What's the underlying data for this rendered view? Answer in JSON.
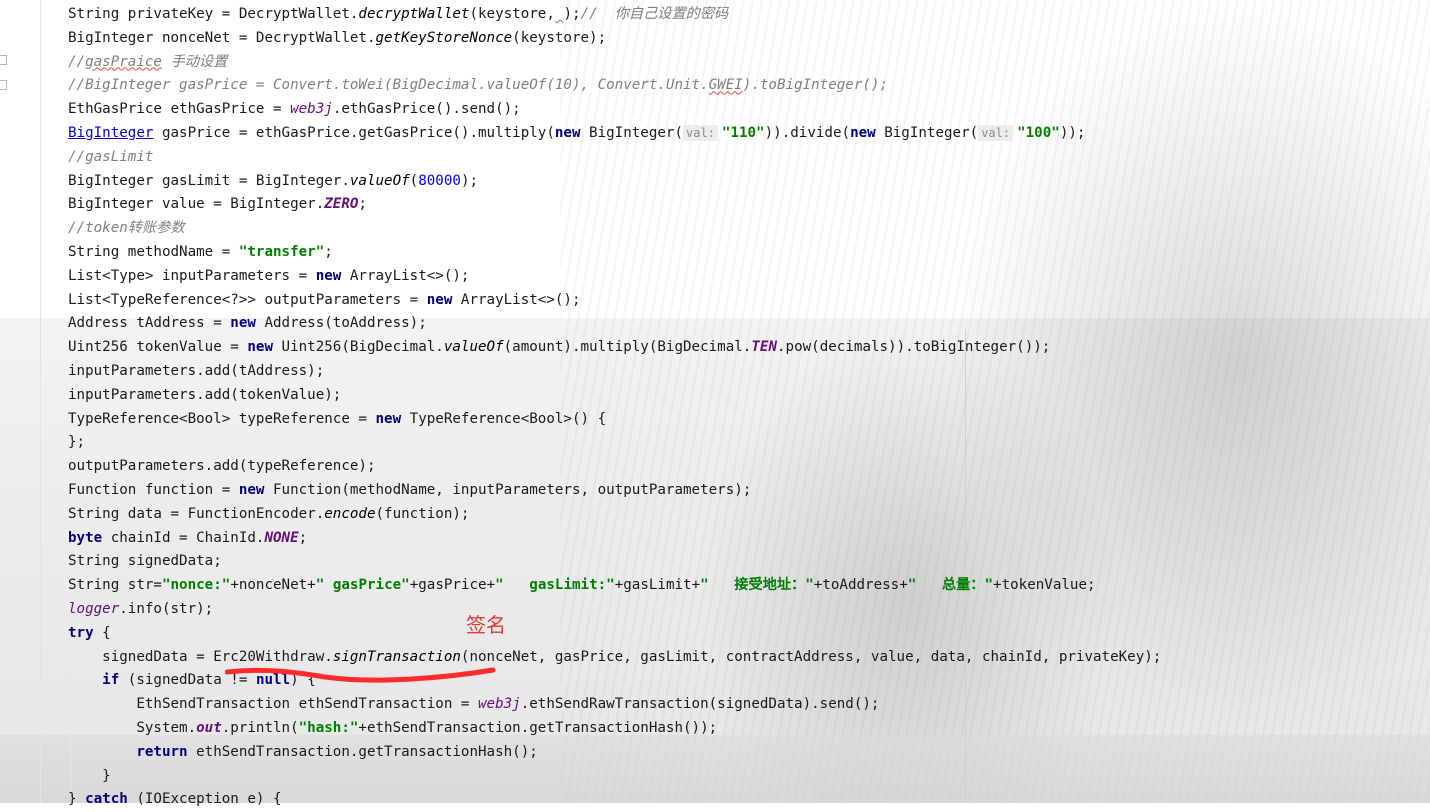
{
  "editor": {
    "annotation_label": "签名",
    "lines": [
      [
        {
          "t": "String privateKey = DecryptWallet."
        },
        {
          "t": "decryptWallet",
          "c": "st"
        },
        {
          "t": "(keystore,"
        },
        {
          "t": " ",
          "c": "squig"
        },
        {
          "t": ");"
        },
        {
          "t": "//  你自己设置的密码",
          "c": "cm"
        }
      ],
      [
        {
          "t": "BigInteger nonceNet = DecryptWallet."
        },
        {
          "t": "getKeyStoreNonce",
          "c": "st"
        },
        {
          "t": "(keystore);"
        }
      ],
      [
        {
          "t": "//",
          "c": "cm"
        },
        {
          "t": "gasPraice",
          "c": "cm squig"
        },
        {
          "t": " 手动设置",
          "c": "cm"
        }
      ],
      [
        {
          "t": "//BigInteger gasPrice = Convert.toWei(BigDecimal.valueOf(10), Convert.Unit.",
          "c": "cm"
        },
        {
          "t": "GWEI",
          "c": "cm squig"
        },
        {
          "t": ").toBigInteger();",
          "c": "cm"
        }
      ],
      [
        {
          "t": "EthGasPrice ethGasPrice = "
        },
        {
          "t": "web3j",
          "c": "fi"
        },
        {
          "t": ".ethGasPrice().send();"
        }
      ],
      [
        {
          "t": "BigInteger",
          "c": "lnk"
        },
        {
          "t": " gasPrice = ethGasPrice.getGasPrice().multiply("
        },
        {
          "t": "new",
          "c": "kw"
        },
        {
          "t": " BigInteger("
        },
        {
          "t": "val:",
          "c": "hint"
        },
        {
          "t": "\"110\"",
          "c": "str"
        },
        {
          "t": ")).divide("
        },
        {
          "t": "new",
          "c": "kw"
        },
        {
          "t": " BigInteger("
        },
        {
          "t": "val:",
          "c": "hint"
        },
        {
          "t": "\"100\"",
          "c": "str"
        },
        {
          "t": "));"
        }
      ],
      [
        {
          "t": "//gasLimit",
          "c": "cm"
        }
      ],
      [
        {
          "t": "BigInteger gasLimit = BigInteger."
        },
        {
          "t": "valueOf",
          "c": "st"
        },
        {
          "t": "("
        },
        {
          "t": "80000",
          "c": "num"
        },
        {
          "t": ");"
        }
      ],
      [
        {
          "t": "BigInteger value = BigInteger."
        },
        {
          "t": "ZERO",
          "c": "stb"
        },
        {
          "t": ";"
        }
      ],
      [
        {
          "t": "//token",
          "c": "cm"
        },
        {
          "t": "转账参数",
          "c": "cm"
        }
      ],
      [
        {
          "t": "String methodName = "
        },
        {
          "t": "\"transfer\"",
          "c": "str"
        },
        {
          "t": ";"
        }
      ],
      [
        {
          "t": "List<Type> inputParameters = "
        },
        {
          "t": "new",
          "c": "kw"
        },
        {
          "t": " ArrayList<>();"
        }
      ],
      [
        {
          "t": "List<TypeReference<?>> outputParameters = "
        },
        {
          "t": "new",
          "c": "kw"
        },
        {
          "t": " ArrayList<>();"
        }
      ],
      [
        {
          "t": "Address tAddress = "
        },
        {
          "t": "new",
          "c": "kw"
        },
        {
          "t": " Address(toAddress);"
        }
      ],
      [
        {
          "t": "Uint256 tokenValue = "
        },
        {
          "t": "new",
          "c": "kw"
        },
        {
          "t": " Uint256(BigDecimal."
        },
        {
          "t": "valueOf",
          "c": "st"
        },
        {
          "t": "(amount).multiply(BigDecimal."
        },
        {
          "t": "TEN",
          "c": "stb"
        },
        {
          "t": ".pow(decimals)).toBigInteger());"
        }
      ],
      [
        {
          "t": "inputParameters.add(tAddress);"
        }
      ],
      [
        {
          "t": "inputParameters.add(tokenValue);"
        }
      ],
      [
        {
          "t": "TypeReference<Bool> typeReference = "
        },
        {
          "t": "new",
          "c": "kw"
        },
        {
          "t": " TypeReference<Bool>() {"
        }
      ],
      [
        {
          "t": "};"
        }
      ],
      [
        {
          "t": "outputParameters.add(typeReference);"
        }
      ],
      [
        {
          "t": "Function function = "
        },
        {
          "t": "new",
          "c": "kw"
        },
        {
          "t": " Function(methodName, inputParameters, outputParameters);"
        }
      ],
      [
        {
          "t": "String data = FunctionEncoder."
        },
        {
          "t": "encode",
          "c": "st"
        },
        {
          "t": "(function);"
        }
      ],
      [
        {
          "t": "byte",
          "c": "kw"
        },
        {
          "t": " chainId = ChainId."
        },
        {
          "t": "NONE",
          "c": "stb"
        },
        {
          "t": ";"
        }
      ],
      [
        {
          "t": "String signedData;"
        }
      ],
      [
        {
          "t": "String str="
        },
        {
          "t": "\"nonce:\"",
          "c": "str"
        },
        {
          "t": "+nonceNet+"
        },
        {
          "t": "\" gasPrice\"",
          "c": "str"
        },
        {
          "t": "+gasPrice+"
        },
        {
          "t": "\"   gasLimit:\"",
          "c": "str"
        },
        {
          "t": "+gasLimit+"
        },
        {
          "t": "\"   接受地址：\"",
          "c": "str"
        },
        {
          "t": "+toAddress+"
        },
        {
          "t": "\"   总量：\"",
          "c": "str"
        },
        {
          "t": "+tokenValue;"
        }
      ],
      [
        {
          "t": "logger",
          "c": "fi"
        },
        {
          "t": ".info(str);"
        }
      ],
      [
        {
          "t": "try",
          "c": "kw"
        },
        {
          "t": " {"
        }
      ],
      [
        {
          "t": "    signedData = Erc20Withdraw."
        },
        {
          "t": "signTransaction",
          "c": "st"
        },
        {
          "t": "(nonceNet, gasPrice, gasLimit, contractAddress, value, data, chainId, privateKey);"
        }
      ],
      [
        {
          "t": "    "
        },
        {
          "t": "if",
          "c": "kw"
        },
        {
          "t": " (signedData != "
        },
        {
          "t": "null",
          "c": "kw"
        },
        {
          "t": ") {"
        }
      ],
      [
        {
          "t": "        EthSendTransaction ethSendTransaction = "
        },
        {
          "t": "web3j",
          "c": "fi"
        },
        {
          "t": ".ethSendRawTransaction(signedData).send();"
        }
      ],
      [
        {
          "t": "        System."
        },
        {
          "t": "out",
          "c": "stb"
        },
        {
          "t": ".println("
        },
        {
          "t": "\"hash:\"",
          "c": "str"
        },
        {
          "t": "+ethSendTransaction.getTransactionHash());"
        }
      ],
      [
        {
          "t": "        "
        },
        {
          "t": "return",
          "c": "kw"
        },
        {
          "t": " ethSendTransaction.getTransactionHash();"
        }
      ],
      [
        {
          "t": "    }"
        }
      ],
      [
        {
          "t": "} "
        },
        {
          "t": "catch",
          "c": "kw"
        },
        {
          "t": " (IOException e) {"
        }
      ]
    ]
  }
}
